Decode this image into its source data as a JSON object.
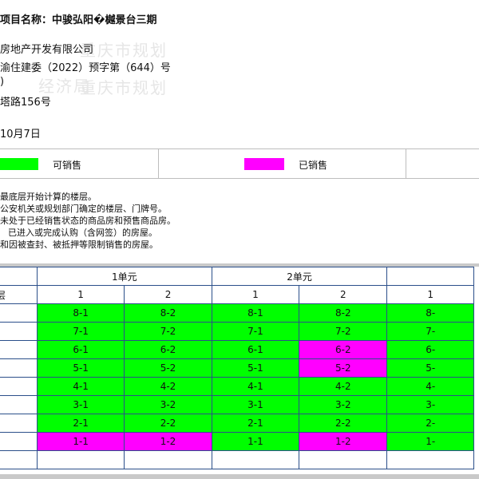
{
  "project": {
    "title": "项目名称：中骏弘阳�樾景台三期",
    "developer": "房地产开发有限公司",
    "permit": "渝住建委（2022）预字第（644）号",
    "line3": ")",
    "address": "塔路156号",
    "date": "10月7日"
  },
  "watermarks": [
    "重庆市规划",
    "经济局",
    "重庆市规划"
  ],
  "legend": {
    "available": {
      "label": "可销售",
      "color": "#00ff00"
    },
    "sold": {
      "label": "已销售",
      "color": "#ff00ff"
    }
  },
  "notes": [
    "最底层开始计算的楼层。",
    "公安机关或规划部门确定的楼层、门牌号。",
    "未处于已经销售状态的商品房和预售商品房。",
    "已进入或完成认购（含网签）的房屋。",
    "和因被查封、被抵押等限制销售的房屋。"
  ],
  "table": {
    "floor_header": "层",
    "units": [
      {
        "name": "1单元",
        "rooms": [
          "1",
          "2"
        ]
      },
      {
        "name": "2单元",
        "rooms": [
          "1",
          "2"
        ]
      },
      {
        "name": "",
        "rooms": [
          "1"
        ]
      }
    ],
    "rows": [
      {
        "cells": [
          {
            "label": "8-1",
            "status": "available"
          },
          {
            "label": "8-2",
            "status": "available"
          },
          {
            "label": "8-1",
            "status": "available"
          },
          {
            "label": "8-2",
            "status": "available"
          },
          {
            "label": "8-",
            "status": "available"
          }
        ]
      },
      {
        "cells": [
          {
            "label": "7-1",
            "status": "available"
          },
          {
            "label": "7-2",
            "status": "available"
          },
          {
            "label": "7-1",
            "status": "available"
          },
          {
            "label": "7-2",
            "status": "available"
          },
          {
            "label": "7-",
            "status": "available"
          }
        ]
      },
      {
        "cells": [
          {
            "label": "6-1",
            "status": "available"
          },
          {
            "label": "6-2",
            "status": "available"
          },
          {
            "label": "6-1",
            "status": "available"
          },
          {
            "label": "6-2",
            "status": "sold"
          },
          {
            "label": "6-",
            "status": "available"
          }
        ]
      },
      {
        "cells": [
          {
            "label": "5-1",
            "status": "available"
          },
          {
            "label": "5-2",
            "status": "available"
          },
          {
            "label": "5-1",
            "status": "available"
          },
          {
            "label": "5-2",
            "status": "sold"
          },
          {
            "label": "5-",
            "status": "available"
          }
        ]
      },
      {
        "cells": [
          {
            "label": "4-1",
            "status": "available"
          },
          {
            "label": "4-2",
            "status": "available"
          },
          {
            "label": "4-1",
            "status": "available"
          },
          {
            "label": "4-2",
            "status": "available"
          },
          {
            "label": "4-",
            "status": "available"
          }
        ]
      },
      {
        "cells": [
          {
            "label": "3-1",
            "status": "available"
          },
          {
            "label": "3-2",
            "status": "available"
          },
          {
            "label": "3-1",
            "status": "available"
          },
          {
            "label": "3-2",
            "status": "available"
          },
          {
            "label": "3-",
            "status": "available"
          }
        ]
      },
      {
        "cells": [
          {
            "label": "2-1",
            "status": "available"
          },
          {
            "label": "2-2",
            "status": "available"
          },
          {
            "label": "2-1",
            "status": "available"
          },
          {
            "label": "2-2",
            "status": "available"
          },
          {
            "label": "2-",
            "status": "available"
          }
        ]
      },
      {
        "cells": [
          {
            "label": "1-1",
            "status": "sold"
          },
          {
            "label": "1-2",
            "status": "sold"
          },
          {
            "label": "1-1",
            "status": "available"
          },
          {
            "label": "1-2",
            "status": "sold"
          },
          {
            "label": "1-",
            "status": "available"
          }
        ]
      }
    ]
  }
}
